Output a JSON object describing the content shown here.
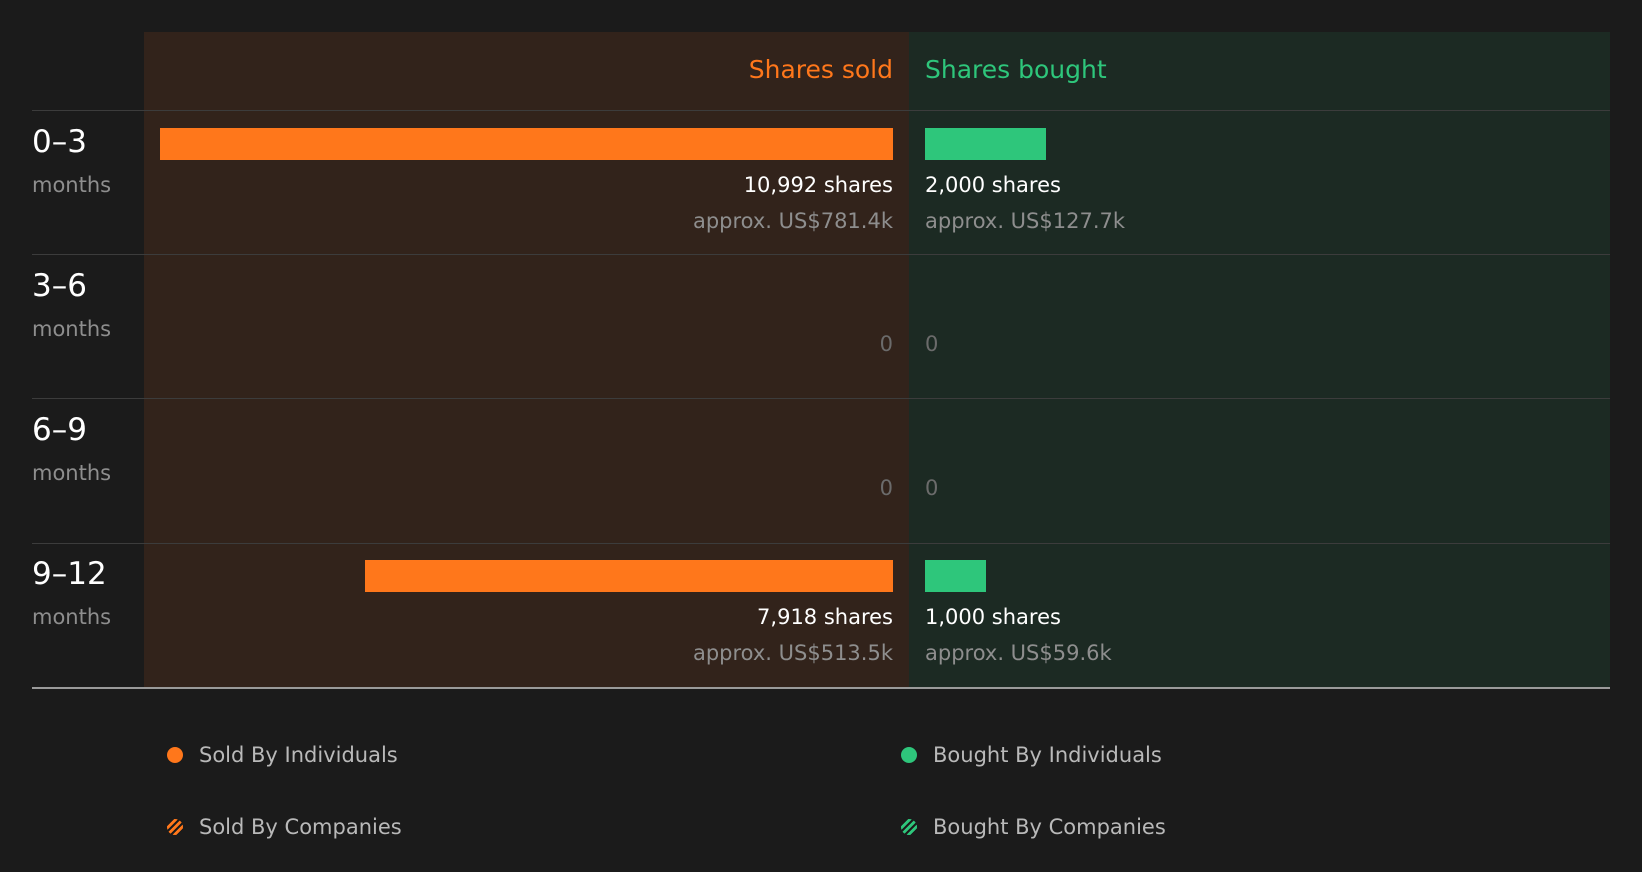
{
  "colors": {
    "sold": "#ff771b",
    "bought": "#2ec67b",
    "sold_background": "#32231b",
    "bought_background": "#1c2a23",
    "page_background": "#1b1b1b"
  },
  "chart_data": {
    "type": "bar",
    "orientation": "horizontal-diverging",
    "title": "",
    "column_headers": {
      "sold": "Shares sold",
      "bought": "Shares bought"
    },
    "categories": [
      {
        "period": "0–3",
        "unit": "months"
      },
      {
        "period": "3–6",
        "unit": "months"
      },
      {
        "period": "6–9",
        "unit": "months"
      },
      {
        "period": "9–12",
        "unit": "months"
      }
    ],
    "series": [
      {
        "name": "Shares sold",
        "values": [
          10992,
          0,
          0,
          7918
        ],
        "labels": [
          "10,992 shares",
          "0",
          "0",
          "7,918 shares"
        ],
        "approx_values": [
          "approx. US$781.4k",
          "",
          "",
          "approx. US$513.5k"
        ]
      },
      {
        "name": "Shares bought",
        "values": [
          2000,
          0,
          0,
          1000
        ],
        "labels": [
          "2,000 shares",
          "0",
          "0",
          "1,000 shares"
        ],
        "approx_values": [
          "approx. US$127.7k",
          "",
          "",
          "approx. US$59.6k"
        ]
      }
    ],
    "xlim": [
      0,
      10992
    ],
    "grid": false,
    "legend_position": "bottom",
    "legend": [
      {
        "label": "Sold By Individuals",
        "color": "#ff771b",
        "style": "solid",
        "icon": "circle-icon"
      },
      {
        "label": "Bought By Individuals",
        "color": "#2ec67b",
        "style": "solid",
        "icon": "circle-icon"
      },
      {
        "label": "Sold By Companies",
        "color": "#ff771b",
        "style": "hatched",
        "icon": "hatched-circle-icon"
      },
      {
        "label": "Bought By Companies",
        "color": "#2ec67b",
        "style": "hatched",
        "icon": "hatched-circle-icon"
      }
    ]
  }
}
